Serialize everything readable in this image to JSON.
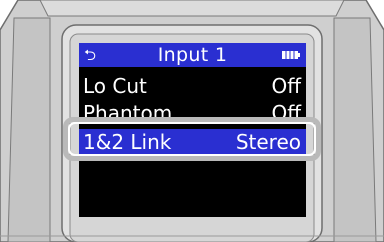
{
  "header": {
    "title": "Input 1",
    "back_icon": "back-arrow-icon",
    "battery_icon": "battery-icon"
  },
  "menu": {
    "items": [
      {
        "label": "Lo Cut",
        "value": "Off",
        "selected": false
      },
      {
        "label": "Phantom",
        "value": "Off",
        "selected": false
      },
      {
        "label": "1&2 Link",
        "value": "Stereo",
        "selected": true
      }
    ]
  },
  "colors": {
    "title_bar": "#2a2fd1",
    "selection": "#2a2fd1",
    "screen_bg": "#000000",
    "text": "#ffffff",
    "device_body": "#d4d4d4"
  }
}
